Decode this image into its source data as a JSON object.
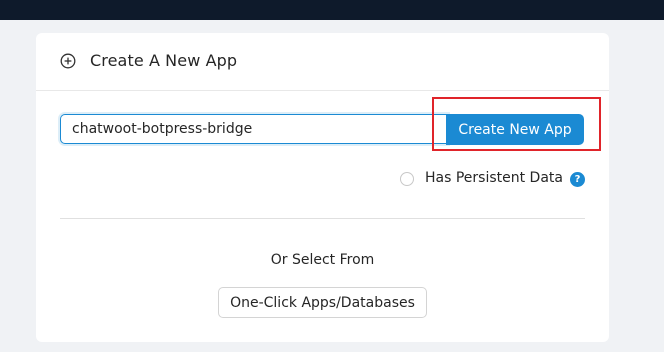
{
  "header": {
    "title": "Create A New App",
    "icon": "plus-circle-icon"
  },
  "form": {
    "app_name_value": "chatwoot-botpress-bridge",
    "create_button_label": "Create New App",
    "persistent_label": "Has Persistent Data",
    "persistent_checked": false,
    "help_icon": "?"
  },
  "alternate": {
    "or_text": "Or Select From",
    "oneclick_button_label": "One-Click Apps/Databases"
  },
  "colors": {
    "accent": "#1b8ad3",
    "highlight": "#e0242a",
    "topbar": "#0e1a2b"
  }
}
